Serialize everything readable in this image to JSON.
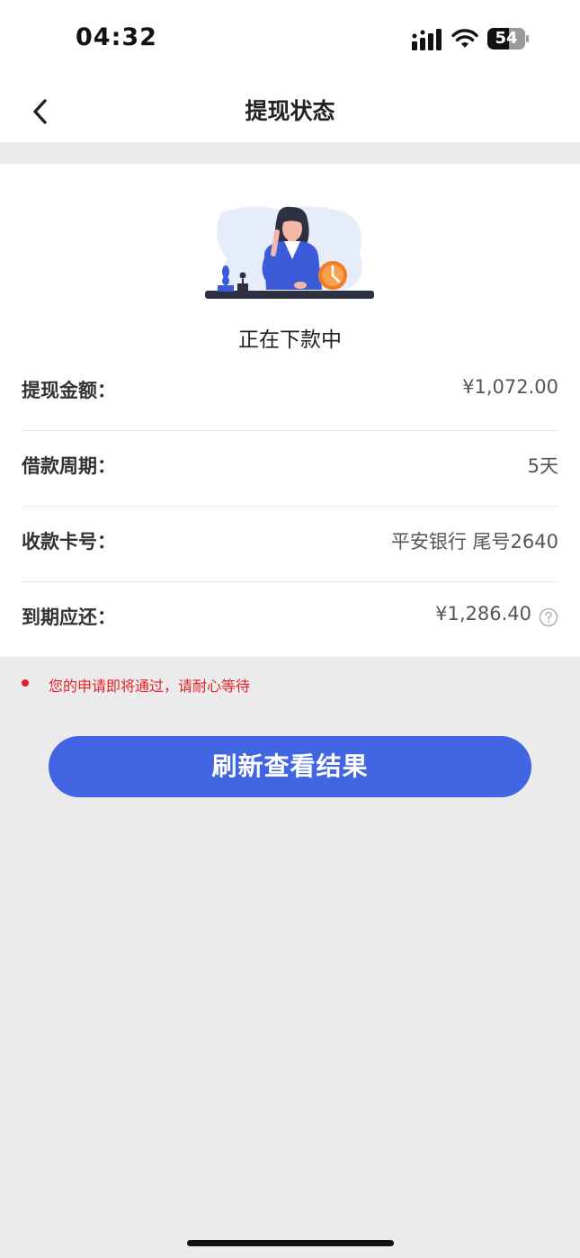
{
  "status_bar": {
    "time": "04:32",
    "battery": "54"
  },
  "nav": {
    "title": "提现状态"
  },
  "status": {
    "text": "正在下款中"
  },
  "details": [
    {
      "label": "提现金额：",
      "value": "¥1,072.00"
    },
    {
      "label": "借款周期：",
      "value": "5天"
    },
    {
      "label": "收款卡号：",
      "value": "平安银行 尾号2640"
    },
    {
      "label": "到期应还：",
      "value": "¥1,286.40"
    }
  ],
  "notice": {
    "text": "您的申请即将通过，请耐心等待"
  },
  "refresh_button": {
    "label": "刷新查看结果"
  },
  "colors": {
    "accent": "#4266e3",
    "notice": "#e8202a",
    "clock": "#f47c20"
  },
  "icons": {
    "back": "back-arrow-icon",
    "help": "question-circle-icon",
    "illustration": "woman-waiting-clock-illustration"
  }
}
